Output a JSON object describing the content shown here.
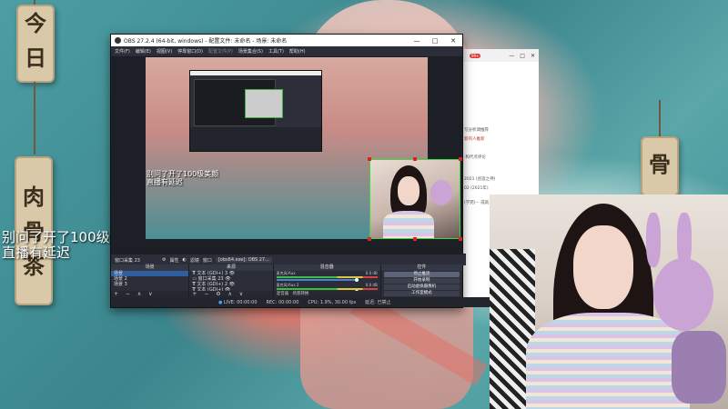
{
  "wall_tags": [
    {
      "chars": [
        "今",
        "日"
      ]
    },
    {
      "chars": [
        "肉",
        "骨",
        "茶"
      ]
    },
    {
      "chars": [
        "骨"
      ]
    }
  ],
  "overlay": {
    "caption_line1": "别问了开了100级美颜",
    "caption_line2": "直播有延迟"
  },
  "obs": {
    "title": "OBS 27.2.4 (64-bit, windows) - 配置文件: 未命名 - 场景: 未命名",
    "menu": [
      "文件(F)",
      "编辑(E)",
      "视图(V)",
      "停靠窗口(D)",
      "配置文件(P)",
      "场景集合(S)",
      "工具(T)",
      "帮助(H)"
    ],
    "preview_caption_line1": "别问了开了100级美颜",
    "preview_caption_line2": "直播有延迟",
    "source_bar": {
      "current_source": "窗口采集 23",
      "props": "属性",
      "filters": "滤镜",
      "window_label": "窗口",
      "window_value": "[obs64.exe]: OBS 27..."
    },
    "scenes": {
      "header": "场景",
      "items": [
        "场景",
        "场景 2",
        "场景 3"
      ]
    },
    "sources": {
      "header": "来源",
      "items": [
        "文本 (GDI+) 3",
        "窗口采集 23",
        "文本 (GDI+) 2",
        "文本 (GDI+)",
        "窗口采集 2"
      ]
    },
    "mixer": {
      "header": "混音器",
      "tracks": [
        {
          "name": "麦克风/Aux",
          "db": "0.0 dB"
        },
        {
          "name": "麦克风/Aux 2",
          "db": "0.0 dB"
        }
      ],
      "tab1": "混音器",
      "tab2": "场景转换"
    },
    "controls": {
      "header": "控件",
      "buttons": [
        "停止推流",
        "开始录制",
        "启动虚拟摄像机",
        "工作室模式",
        "设置",
        "退出"
      ]
    },
    "status": {
      "live": "LIVE: 00:00:00",
      "rec": "REC: 00:00:00",
      "cpu": "CPU: 1.9%, 30.00 fps",
      "extra": "延迟: 已禁止"
    },
    "window_buttons": [
      "—",
      "□",
      "✕"
    ]
  },
  "browser": {
    "badge": "99+",
    "window_buttons": [
      "—",
      "□",
      "✕"
    ],
    "lines": [
      "写分析调推荐",
      "新的人推新",
      "·和代点评论",
      "2021 (创造之神)",
      "02 (2021年)",
      "(学苑)··· 成就"
    ]
  },
  "colors": {
    "obs_bg": "#2b2e38",
    "selection_green": "#3ed83e",
    "handle_red": "#e02020",
    "accent_blue": "#2f5f9c"
  }
}
